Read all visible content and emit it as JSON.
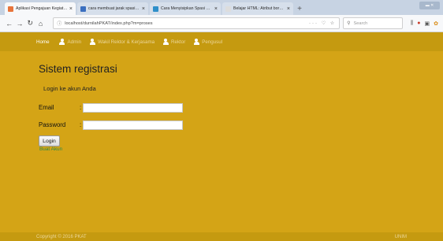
{
  "browser": {
    "tabs": [
      {
        "title": "Aplikasi Pengajuan Kegiatan B...",
        "favicon_color": "#e8743b",
        "active": true
      },
      {
        "title": "cara membuat jarak spasi di p...",
        "favicon_color": "#3b6fbf",
        "active": false
      },
      {
        "title": "Cara Menyisipkan Spasi Dalam...",
        "favicon_color": "#2f8fc9",
        "active": false
      },
      {
        "title": "Belajar HTML: Atribut borde...",
        "favicon_color": "#dddddd",
        "active": false
      }
    ],
    "new_tab": "+",
    "url": "localhost/durnilahPKAT/index.php?m=proses",
    "search_placeholder": "Search"
  },
  "header": {
    "menu": [
      {
        "label": "Home",
        "icon": "none"
      },
      {
        "label": "Admin",
        "icon": "user-icon"
      },
      {
        "label": "Wakil Rektor & Kerjasama",
        "icon": "user-icon"
      },
      {
        "label": "Rektor",
        "icon": "user-icon"
      },
      {
        "label": "Pengusul",
        "icon": "user-icon"
      }
    ]
  },
  "main": {
    "title": "Sistem registrasi",
    "subtitle": "Login ke akun Anda",
    "email_label": "Email",
    "password_label": "Password",
    "colon": ":",
    "email_value": "",
    "password_value": "",
    "login_label": "Login",
    "create_account_label": "Buat Akun"
  },
  "footer": {
    "copyright": "Copyright © 2016 PKAT",
    "right_text": "UNIM"
  },
  "colors": {
    "page_background": "#d4a416",
    "header_background": "#c59a10",
    "link": "#2f8a49"
  }
}
